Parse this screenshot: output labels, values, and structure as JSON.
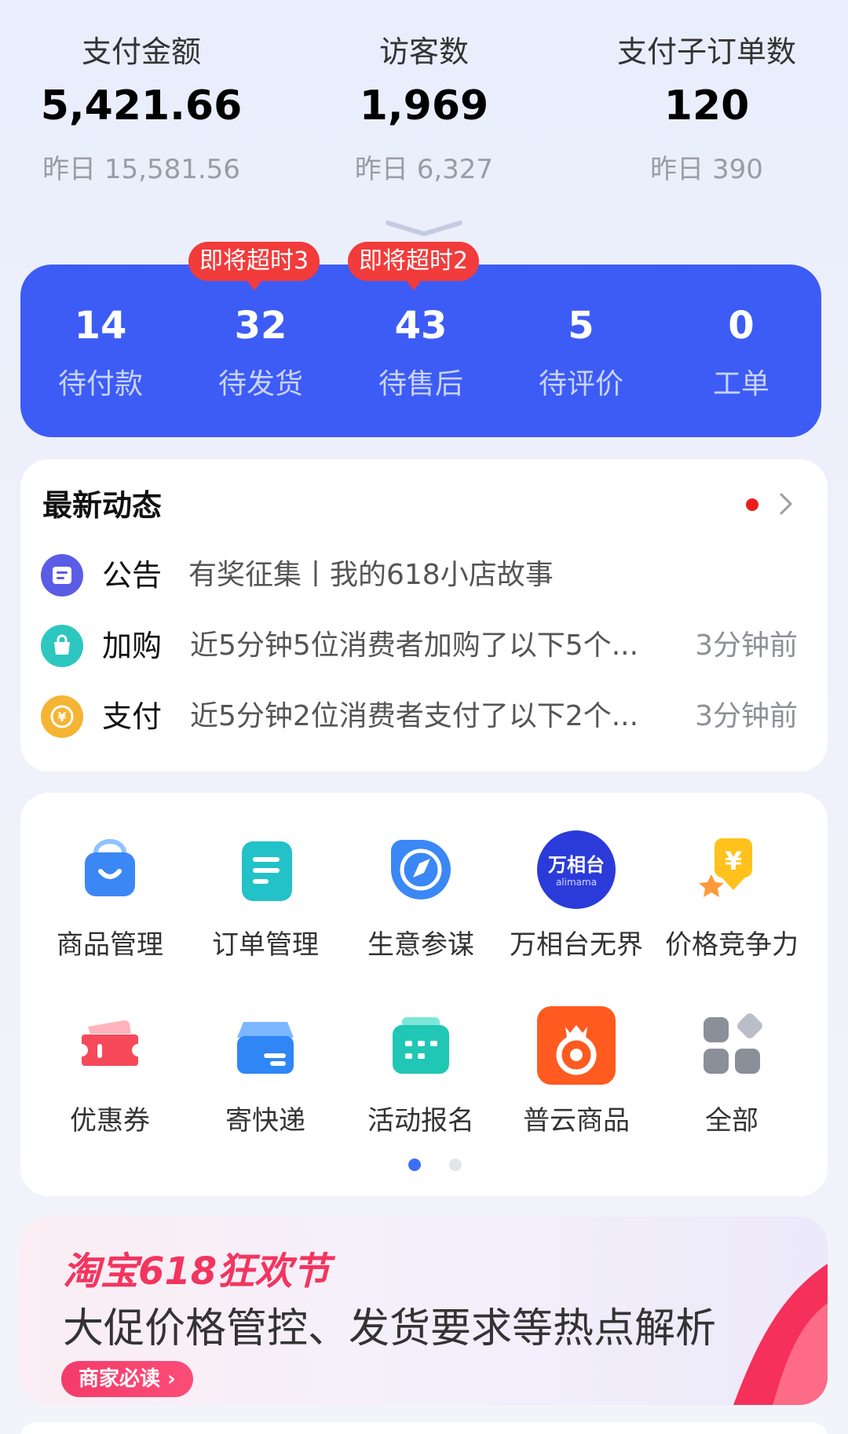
{
  "stats": [
    {
      "label": "支付金额",
      "value": "5,421.66",
      "yesterday": "昨日 15,581.56"
    },
    {
      "label": "访客数",
      "value": "1,969",
      "yesterday": "昨日 6,327"
    },
    {
      "label": "支付子订单数",
      "value": "120",
      "yesterday": "昨日 390"
    }
  ],
  "orders": [
    {
      "count": "14",
      "label": "待付款"
    },
    {
      "count": "32",
      "label": "待发货"
    },
    {
      "count": "43",
      "label": "待售后"
    },
    {
      "count": "5",
      "label": "待评价"
    },
    {
      "count": "0",
      "label": "工单"
    }
  ],
  "badges": {
    "ship": "即将超时3",
    "aftersale": "即将超时2"
  },
  "news": {
    "title": "最新动态",
    "items": [
      {
        "tag": "公告",
        "text": "有奖征集丨我的618小店故事",
        "time": "",
        "icon": "announcement-icon",
        "color": "#5b5ce6"
      },
      {
        "tag": "加购",
        "text": "近5分钟5位消费者加购了以下5个...",
        "time": "3分钟前",
        "icon": "cart-bag-icon",
        "color": "#2ec7c0"
      },
      {
        "tag": "支付",
        "text": "近5分钟2位消费者支付了以下2个...",
        "time": "3分钟前",
        "icon": "yuan-coin-icon",
        "color": "#f5b433"
      }
    ]
  },
  "tools": [
    {
      "label": "商品管理",
      "icon": "shopping-bag-icon"
    },
    {
      "label": "订单管理",
      "icon": "order-list-icon"
    },
    {
      "label": "生意参谋",
      "icon": "compass-icon"
    },
    {
      "label": "万相台无界",
      "icon": "wanxiangtai-logo",
      "logo_text": "万相台",
      "logo_sub": "alimama"
    },
    {
      "label": "价格竞争力",
      "icon": "price-tag-icon"
    },
    {
      "label": "优惠券",
      "icon": "coupon-icon"
    },
    {
      "label": "寄快递",
      "icon": "courier-box-icon"
    },
    {
      "label": "活动报名",
      "icon": "calendar-icon"
    },
    {
      "label": "普云商品",
      "icon": "puyun-logo"
    },
    {
      "label": "全部",
      "icon": "grid-all-icon"
    }
  ],
  "banner": {
    "headline": "淘宝618狂欢节",
    "subtitle": "大促价格管控、发货要求等热点解析",
    "button": "商家必读 ›"
  },
  "colors": {
    "accent": "#3d5cf5",
    "badge": "#f23b3b",
    "red_dot": "#ee1d1d"
  }
}
